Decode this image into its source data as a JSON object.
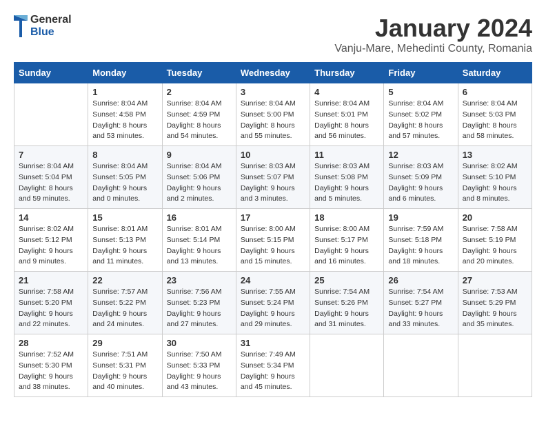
{
  "logo": {
    "line1": "General",
    "line2": "Blue"
  },
  "title": "January 2024",
  "location": "Vanju-Mare, Mehedinti County, Romania",
  "days_of_week": [
    "Sunday",
    "Monday",
    "Tuesday",
    "Wednesday",
    "Thursday",
    "Friday",
    "Saturday"
  ],
  "weeks": [
    [
      {
        "day": "",
        "info": ""
      },
      {
        "day": "1",
        "info": "Sunrise: 8:04 AM\nSunset: 4:58 PM\nDaylight: 8 hours\nand 53 minutes."
      },
      {
        "day": "2",
        "info": "Sunrise: 8:04 AM\nSunset: 4:59 PM\nDaylight: 8 hours\nand 54 minutes."
      },
      {
        "day": "3",
        "info": "Sunrise: 8:04 AM\nSunset: 5:00 PM\nDaylight: 8 hours\nand 55 minutes."
      },
      {
        "day": "4",
        "info": "Sunrise: 8:04 AM\nSunset: 5:01 PM\nDaylight: 8 hours\nand 56 minutes."
      },
      {
        "day": "5",
        "info": "Sunrise: 8:04 AM\nSunset: 5:02 PM\nDaylight: 8 hours\nand 57 minutes."
      },
      {
        "day": "6",
        "info": "Sunrise: 8:04 AM\nSunset: 5:03 PM\nDaylight: 8 hours\nand 58 minutes."
      }
    ],
    [
      {
        "day": "7",
        "info": "Sunrise: 8:04 AM\nSunset: 5:04 PM\nDaylight: 8 hours\nand 59 minutes."
      },
      {
        "day": "8",
        "info": "Sunrise: 8:04 AM\nSunset: 5:05 PM\nDaylight: 9 hours\nand 0 minutes."
      },
      {
        "day": "9",
        "info": "Sunrise: 8:04 AM\nSunset: 5:06 PM\nDaylight: 9 hours\nand 2 minutes."
      },
      {
        "day": "10",
        "info": "Sunrise: 8:03 AM\nSunset: 5:07 PM\nDaylight: 9 hours\nand 3 minutes."
      },
      {
        "day": "11",
        "info": "Sunrise: 8:03 AM\nSunset: 5:08 PM\nDaylight: 9 hours\nand 5 minutes."
      },
      {
        "day": "12",
        "info": "Sunrise: 8:03 AM\nSunset: 5:09 PM\nDaylight: 9 hours\nand 6 minutes."
      },
      {
        "day": "13",
        "info": "Sunrise: 8:02 AM\nSunset: 5:10 PM\nDaylight: 9 hours\nand 8 minutes."
      }
    ],
    [
      {
        "day": "14",
        "info": "Sunrise: 8:02 AM\nSunset: 5:12 PM\nDaylight: 9 hours\nand 9 minutes."
      },
      {
        "day": "15",
        "info": "Sunrise: 8:01 AM\nSunset: 5:13 PM\nDaylight: 9 hours\nand 11 minutes."
      },
      {
        "day": "16",
        "info": "Sunrise: 8:01 AM\nSunset: 5:14 PM\nDaylight: 9 hours\nand 13 minutes."
      },
      {
        "day": "17",
        "info": "Sunrise: 8:00 AM\nSunset: 5:15 PM\nDaylight: 9 hours\nand 15 minutes."
      },
      {
        "day": "18",
        "info": "Sunrise: 8:00 AM\nSunset: 5:17 PM\nDaylight: 9 hours\nand 16 minutes."
      },
      {
        "day": "19",
        "info": "Sunrise: 7:59 AM\nSunset: 5:18 PM\nDaylight: 9 hours\nand 18 minutes."
      },
      {
        "day": "20",
        "info": "Sunrise: 7:58 AM\nSunset: 5:19 PM\nDaylight: 9 hours\nand 20 minutes."
      }
    ],
    [
      {
        "day": "21",
        "info": "Sunrise: 7:58 AM\nSunset: 5:20 PM\nDaylight: 9 hours\nand 22 minutes."
      },
      {
        "day": "22",
        "info": "Sunrise: 7:57 AM\nSunset: 5:22 PM\nDaylight: 9 hours\nand 24 minutes."
      },
      {
        "day": "23",
        "info": "Sunrise: 7:56 AM\nSunset: 5:23 PM\nDaylight: 9 hours\nand 27 minutes."
      },
      {
        "day": "24",
        "info": "Sunrise: 7:55 AM\nSunset: 5:24 PM\nDaylight: 9 hours\nand 29 minutes."
      },
      {
        "day": "25",
        "info": "Sunrise: 7:54 AM\nSunset: 5:26 PM\nDaylight: 9 hours\nand 31 minutes."
      },
      {
        "day": "26",
        "info": "Sunrise: 7:54 AM\nSunset: 5:27 PM\nDaylight: 9 hours\nand 33 minutes."
      },
      {
        "day": "27",
        "info": "Sunrise: 7:53 AM\nSunset: 5:29 PM\nDaylight: 9 hours\nand 35 minutes."
      }
    ],
    [
      {
        "day": "28",
        "info": "Sunrise: 7:52 AM\nSunset: 5:30 PM\nDaylight: 9 hours\nand 38 minutes."
      },
      {
        "day": "29",
        "info": "Sunrise: 7:51 AM\nSunset: 5:31 PM\nDaylight: 9 hours\nand 40 minutes."
      },
      {
        "day": "30",
        "info": "Sunrise: 7:50 AM\nSunset: 5:33 PM\nDaylight: 9 hours\nand 43 minutes."
      },
      {
        "day": "31",
        "info": "Sunrise: 7:49 AM\nSunset: 5:34 PM\nDaylight: 9 hours\nand 45 minutes."
      },
      {
        "day": "",
        "info": ""
      },
      {
        "day": "",
        "info": ""
      },
      {
        "day": "",
        "info": ""
      }
    ]
  ]
}
